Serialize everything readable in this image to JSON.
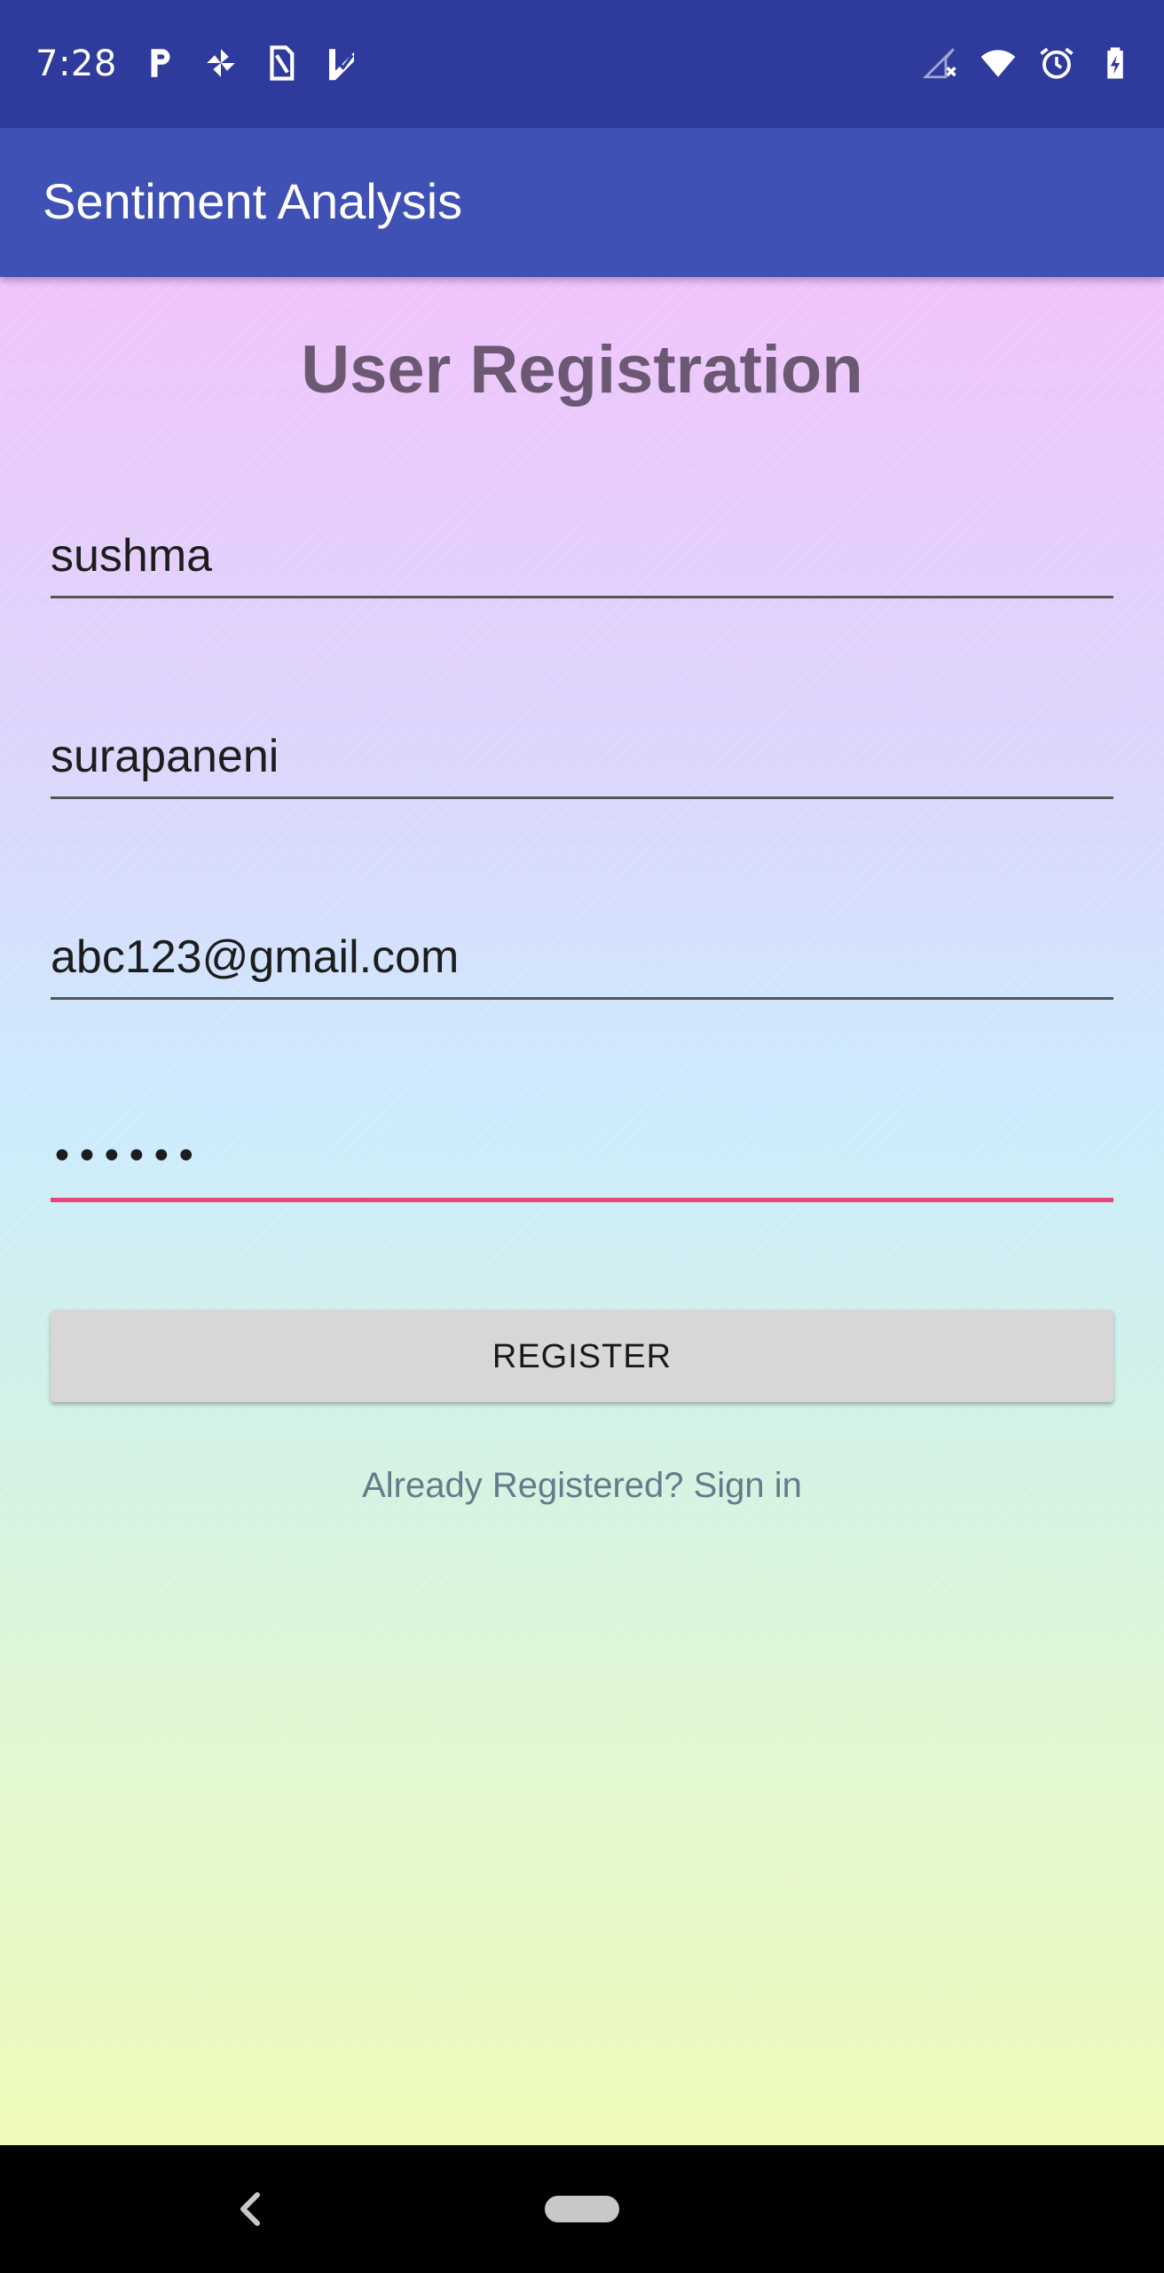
{
  "status_bar": {
    "time": "7:28",
    "left_icons": [
      "parking-app-icon",
      "pinwheel-app-icon",
      "sim-card-icon",
      "checklist-app-icon"
    ],
    "right_icons": [
      "signal-no-service-icon",
      "wifi-icon",
      "alarm-icon",
      "battery-charging-icon"
    ]
  },
  "app_bar": {
    "title": "Sentiment Analysis",
    "color": "#3f51b5"
  },
  "form": {
    "heading": "User Registration",
    "fields": {
      "first_name": "sushma",
      "last_name": "surapaneni",
      "email": "abc123@gmail.com",
      "password_masked": "••••••"
    },
    "register_label": "REGISTER",
    "signin_text": "Already Registered? Sign in",
    "accent_color": "#e9457a"
  },
  "nav_bar": {
    "icons": [
      "back-icon",
      "home-pill-icon"
    ]
  }
}
